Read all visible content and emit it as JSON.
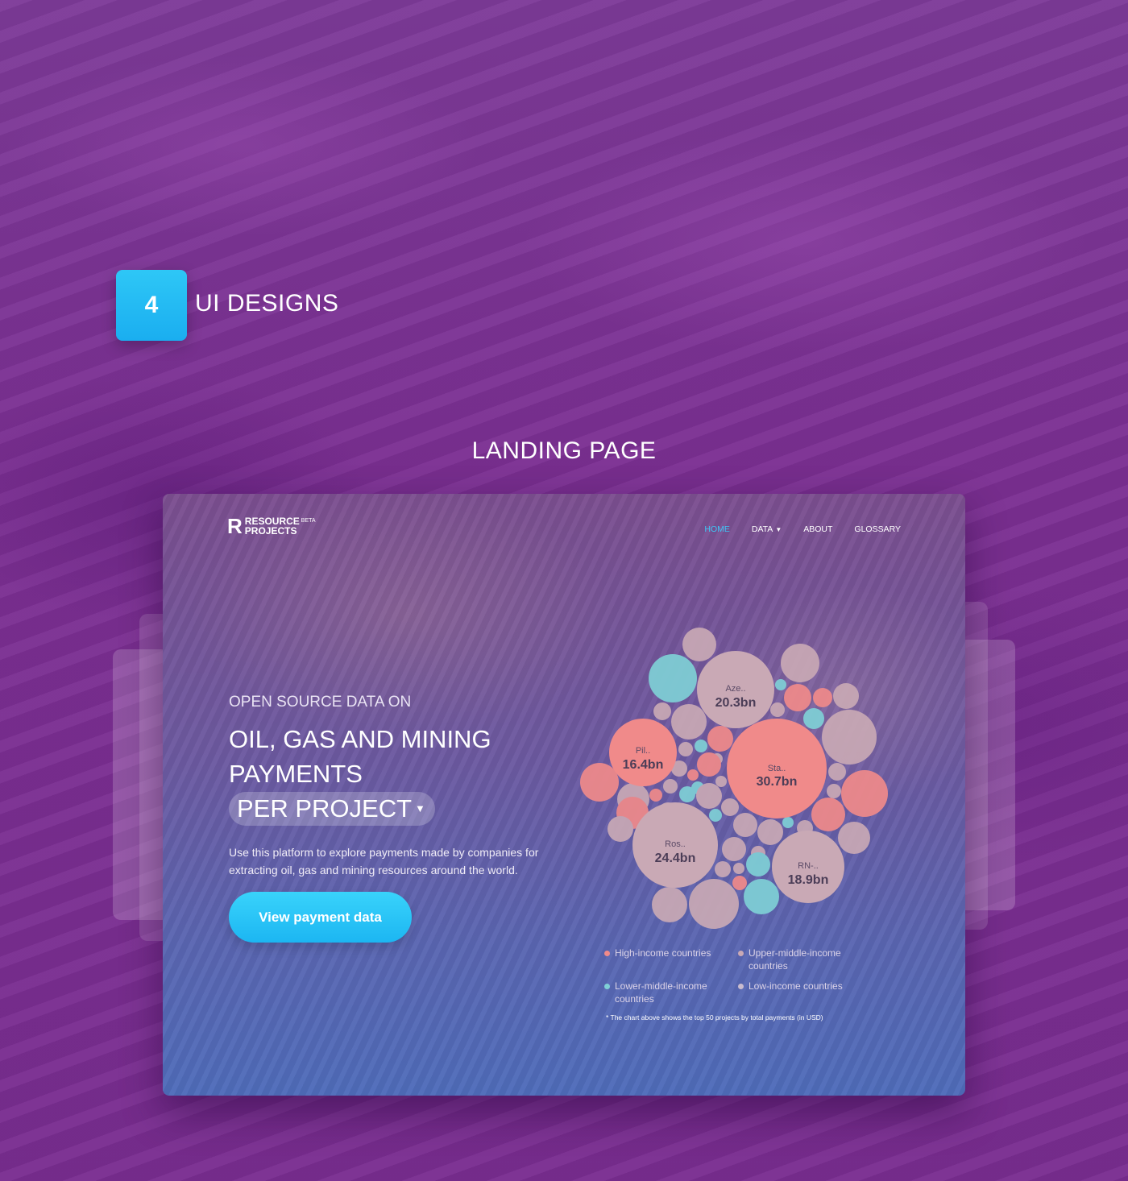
{
  "section": {
    "number": "4",
    "title": "UI DESIGNS"
  },
  "subsection": {
    "title": "LANDING PAGE"
  },
  "mockup": {
    "logo": {
      "mark": "R",
      "line1": "RESOURCE",
      "beta": "BETA",
      "line2": "PROJECTS"
    },
    "nav": [
      {
        "label": "HOME",
        "active": true
      },
      {
        "label": "DATA",
        "dropdown": true
      },
      {
        "label": "ABOUT"
      },
      {
        "label": "GLOSSARY"
      }
    ],
    "hero": {
      "kicker": "OPEN SOURCE DATA ON",
      "title": "OIL, GAS AND MINING PAYMENTS",
      "selector": "PER PROJECT",
      "description": "Use this platform to explore payments made by companies for extracting oil, gas and mining resources around the world.",
      "cta": "View payment data"
    },
    "legend": [
      {
        "label": "High-income countries",
        "color": "#f08a8a"
      },
      {
        "label": "Upper-middle-income countries",
        "color": "#c9a9b5"
      },
      {
        "label": "Lower-middle-income countries",
        "color": "#7fd0d6"
      },
      {
        "label": "Low-income countries",
        "color": "#c9bccf"
      }
    ],
    "chart_note": "* The chart above shows the top 50 projects by total payments (in USD)"
  },
  "chart_data": {
    "type": "bubble",
    "labeled_bubbles": [
      {
        "name": "Sta..",
        "value": "30.7bn",
        "category": "High-income countries"
      },
      {
        "name": "Ros..",
        "value": "24.4bn",
        "category": "Upper-middle-income countries"
      },
      {
        "name": "Aze..",
        "value": "20.3bn",
        "category": "Upper-middle-income countries"
      },
      {
        "name": "RN-..",
        "value": "18.9bn",
        "category": "Upper-middle-income countries"
      },
      {
        "name": "Pil..",
        "value": "16.4bn",
        "category": "High-income countries"
      }
    ],
    "colors": {
      "high": "#f08a8a",
      "upper_middle": "#c9a9b5",
      "lower_middle": "#7fd0d6"
    }
  }
}
